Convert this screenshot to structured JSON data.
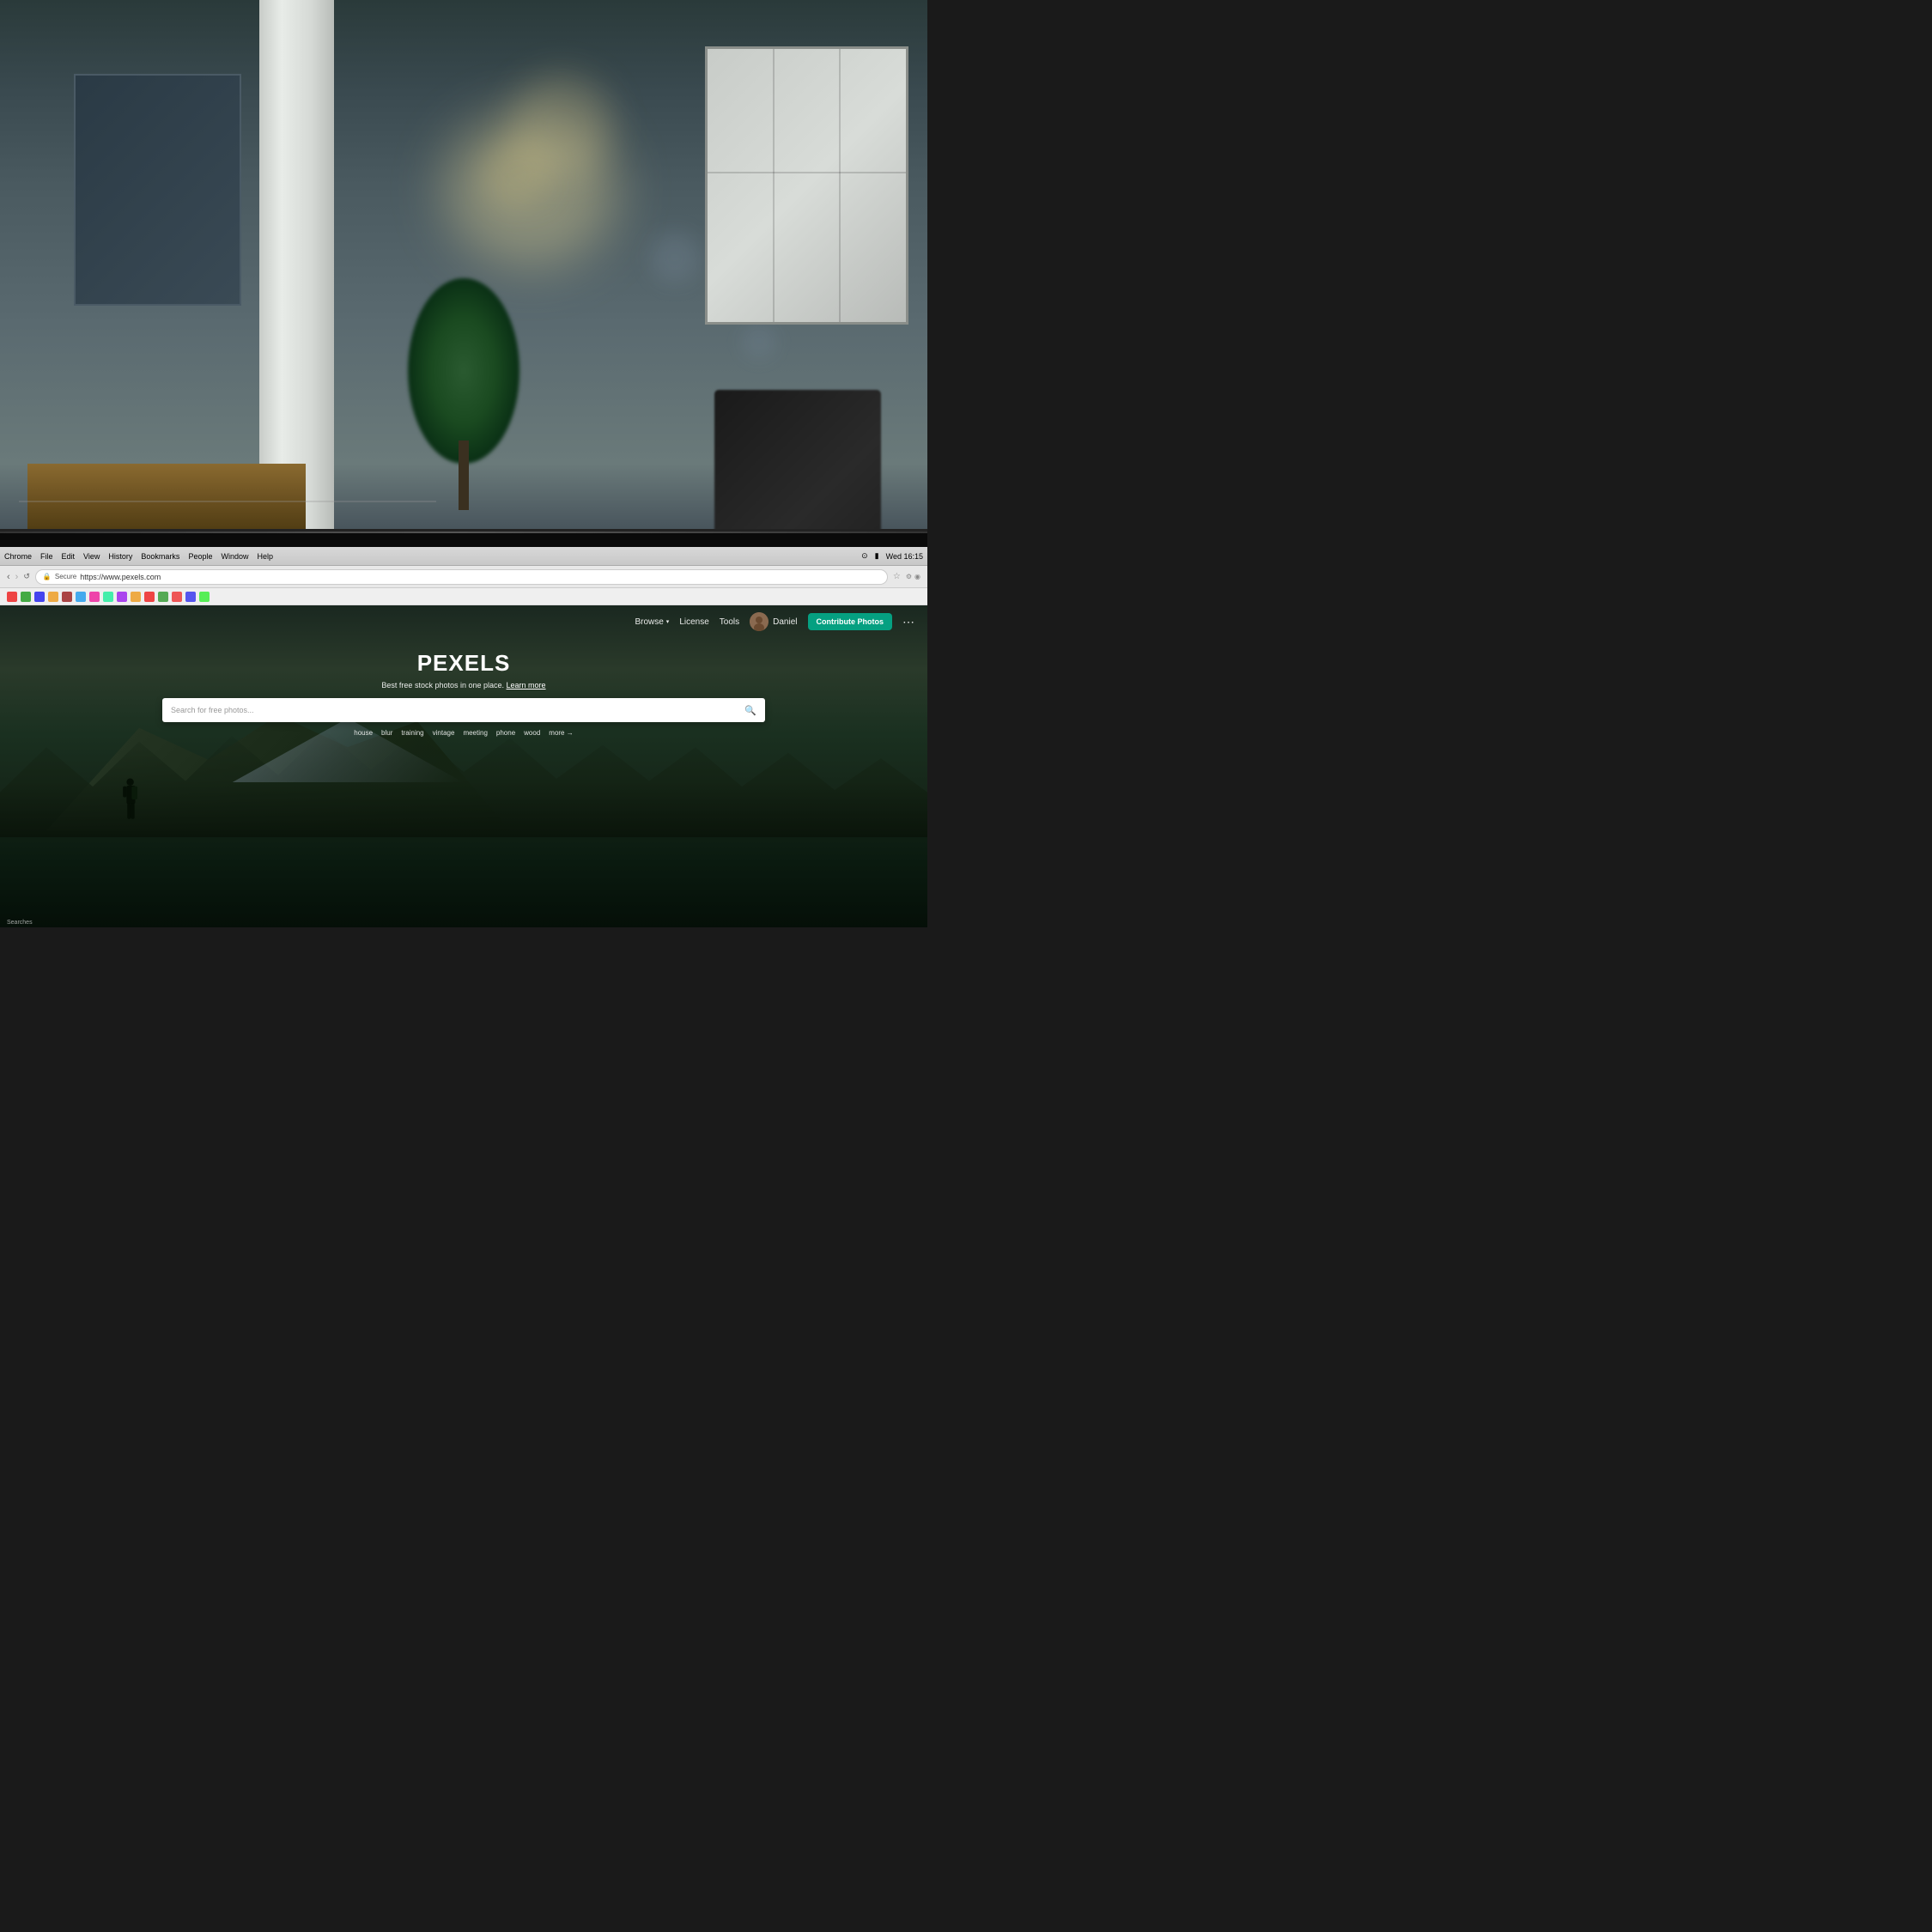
{
  "scene": {
    "title": "Office with Laptop showing Pexels"
  },
  "macos": {
    "menu_items": [
      "Chrome",
      "File",
      "Edit",
      "View",
      "History",
      "Bookmarks",
      "People",
      "Window",
      "Help"
    ],
    "clock": "Wed 16:15",
    "battery": "100%",
    "wifi": "wifi"
  },
  "browser": {
    "secure_label": "Secure",
    "url": "https://www.pexels.com",
    "favicon_colors": [
      "#e33",
      "#4a4",
      "#44e",
      "#ea4",
      "#a4a",
      "#4aa"
    ]
  },
  "pexels": {
    "nav": {
      "browse_label": "Browse",
      "license_label": "License",
      "tools_label": "Tools",
      "user_name": "Daniel",
      "contribute_label": "Contribute Photos",
      "more_label": "..."
    },
    "hero": {
      "logo": "PEXELS",
      "tagline": "Best free stock photos in one place.",
      "learn_more": "Learn more",
      "search_placeholder": "Search for free photos...",
      "tags": [
        "house",
        "blur",
        "training",
        "vintage",
        "meeting",
        "phone",
        "wood"
      ],
      "more_tag": "more →"
    },
    "footer_label": "Searches"
  }
}
